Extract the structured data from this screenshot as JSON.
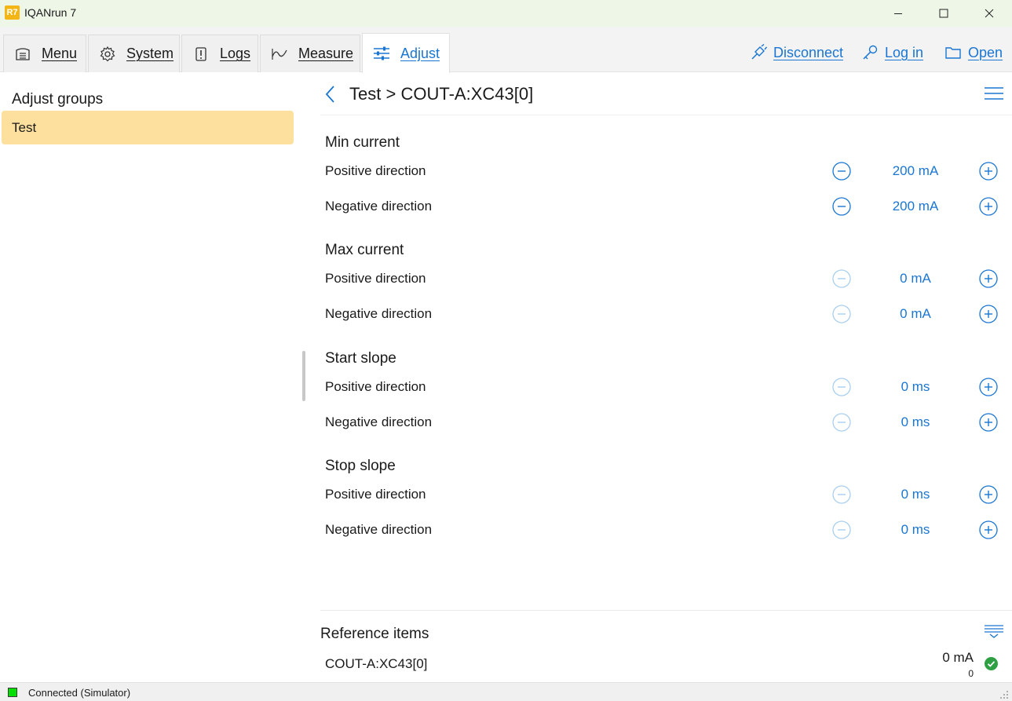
{
  "window": {
    "badge": "R7",
    "title": "IQANrun 7"
  },
  "tabs": [
    {
      "label": "Menu",
      "icon": "menu-icon"
    },
    {
      "label": "System",
      "icon": "gear-icon"
    },
    {
      "label": "Logs",
      "icon": "logs-icon"
    },
    {
      "label": "Measure",
      "icon": "waveform-icon"
    },
    {
      "label": "Adjust",
      "icon": "sliders-icon",
      "active": true
    }
  ],
  "actions": {
    "disconnect": "Disconnect",
    "login": "Log in",
    "open": "Open"
  },
  "sidebar": {
    "title": "Adjust groups",
    "items": [
      {
        "label": "Test",
        "selected": true
      }
    ]
  },
  "breadcrumb": {
    "group": "Test",
    "separator": ">",
    "channel": "COUT-A:XC43[0]"
  },
  "sections": [
    {
      "title": "Min current",
      "rows": [
        {
          "label": "Positive direction",
          "value": "200 mA",
          "minus_enabled": true
        },
        {
          "label": "Negative direction",
          "value": "200 mA",
          "minus_enabled": true
        }
      ]
    },
    {
      "title": "Max current",
      "rows": [
        {
          "label": "Positive direction",
          "value": "0 mA",
          "minus_enabled": false
        },
        {
          "label": "Negative direction",
          "value": "0 mA",
          "minus_enabled": false
        }
      ]
    },
    {
      "title": "Start slope",
      "rows": [
        {
          "label": "Positive direction",
          "value": "0 ms",
          "minus_enabled": false
        },
        {
          "label": "Negative direction",
          "value": "0 ms",
          "minus_enabled": false
        }
      ]
    },
    {
      "title": "Stop slope",
      "rows": [
        {
          "label": "Positive direction",
          "value": "0 ms",
          "minus_enabled": false
        },
        {
          "label": "Negative direction",
          "value": "0 ms",
          "minus_enabled": false
        }
      ]
    }
  ],
  "reference": {
    "title": "Reference items",
    "items": [
      {
        "name": "COUT-A:XC43[0]",
        "value": "0 mA",
        "sub": "0",
        "status": "ok"
      }
    ]
  },
  "status": {
    "text": "Connected (Simulator)"
  },
  "colors": {
    "accent": "#1a76d2",
    "selected": "#fde09d",
    "connected": "#00e000",
    "ok": "#2ea043"
  }
}
